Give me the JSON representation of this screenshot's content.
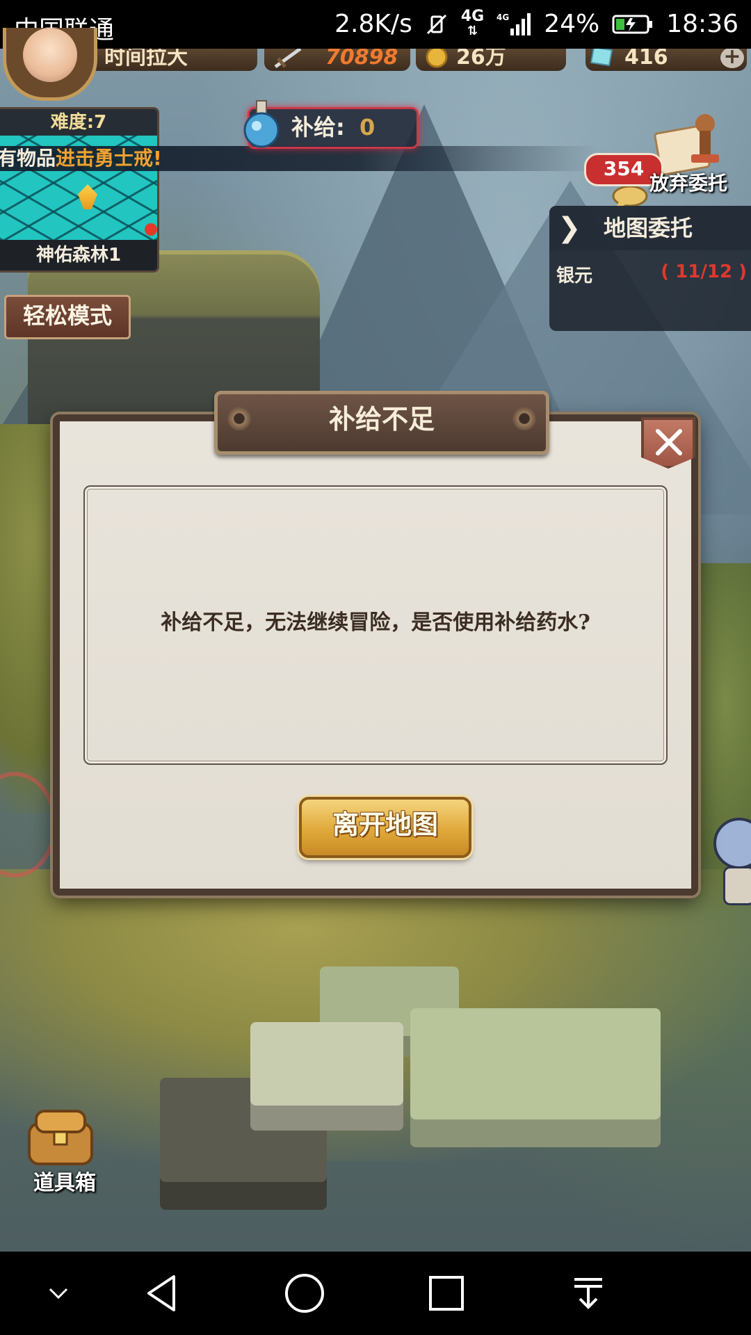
{
  "status_bar": {
    "carrier": "中国联通",
    "net_speed": "2.8K/s",
    "net_type_top": "4G",
    "net_type_bottom": "4G",
    "battery_percent": "24%",
    "time": "18:36"
  },
  "hud": {
    "player_name": "时间拉大",
    "combat_power": "70898",
    "coins": "26万",
    "gems": "416",
    "add_label": "+"
  },
  "minimap": {
    "difficulty": "难度:7",
    "location": "神佑森林1"
  },
  "supply": {
    "label": "补给:",
    "value": "0"
  },
  "ticker": {
    "prefix": "有物品",
    "highlight": "进击勇士戒!"
  },
  "abandon": {
    "count": "354",
    "label": "放弃委托"
  },
  "quest_panel": {
    "chevron": "❯",
    "title": "地图委托",
    "items": [
      {
        "name": "银元",
        "progress": "( 11/12 )"
      }
    ]
  },
  "easy_mode": {
    "label": "轻松模式"
  },
  "item_box": {
    "label": "道具箱"
  },
  "dialog": {
    "title": "补给不足",
    "message": "补给不足，无法继续冒险，是否使用补给药水?",
    "leave_button": "离开地图",
    "close_icon": "close-icon"
  },
  "colors": {
    "accent_gold": "#e0a93a",
    "alert_red": "#c9394a",
    "progress_red": "#e0382e",
    "highlight_orange": "#f2a12f"
  }
}
